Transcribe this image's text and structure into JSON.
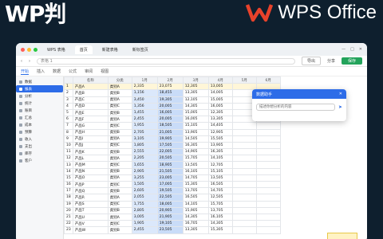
{
  "hero": {
    "title": "WP判",
    "brand_name": "WPS Office"
  },
  "colors": {
    "accent": "#2d6ce8",
    "green": "#23a35b",
    "brand_red": "#e8422b"
  },
  "titlebar": {
    "tab_active": "首页",
    "tab2": "新建表格",
    "tab3": "新标签页",
    "app_label": "WPS 表格"
  },
  "toolbar": {
    "url": "表格 1",
    "share_label": "分享",
    "green_button": "保存",
    "ghost_button": "导出"
  },
  "ribbon": {
    "tabs": [
      "开始",
      "插入",
      "数据",
      "公式",
      "审阅",
      "视图"
    ]
  },
  "sidebar": {
    "items": [
      "数据",
      "报表",
      "分析",
      "统计",
      "账目",
      "汇总",
      "成本",
      "预算",
      "收入",
      "支出",
      "库存",
      "客户"
    ]
  },
  "table": {
    "headers": [
      "",
      "名称",
      "分类",
      "1月",
      "2月",
      "3月",
      "4月",
      "5月",
      "6月"
    ],
    "rows": [
      [
        "1",
        "产品A",
        "类别A",
        "2,335",
        "23,075",
        "12,305",
        "13,005",
        "",
        ""
      ],
      [
        "2",
        "产品B",
        "类别B",
        "1,156",
        "18,455",
        "13,305",
        "14,005",
        "",
        ""
      ],
      [
        "3",
        "产品C",
        "类别A",
        "3,450",
        "19,305",
        "12,105",
        "15,005",
        "",
        ""
      ],
      [
        "4",
        "产品D",
        "类别C",
        "1,356",
        "20,005",
        "14,305",
        "16,005",
        "",
        ""
      ],
      [
        "5",
        "产品E",
        "类别B",
        "1,455",
        "16,005",
        "15,005",
        "12,305",
        "",
        ""
      ],
      [
        "6",
        "产品F",
        "类别A",
        "2,455",
        "20,005",
        "16,005",
        "13,305",
        "",
        ""
      ],
      [
        "7",
        "产品G",
        "类别C",
        "1,955",
        "18,505",
        "15,105",
        "14,405",
        "",
        ""
      ],
      [
        "8",
        "产品H",
        "类别B",
        "2,705",
        "21,005",
        "13,905",
        "12,905",
        "",
        ""
      ],
      [
        "9",
        "产品I",
        "类别A",
        "3,105",
        "19,905",
        "14,505",
        "15,505",
        "",
        ""
      ],
      [
        "10",
        "产品J",
        "类别C",
        "1,805",
        "17,505",
        "16,305",
        "13,905",
        "",
        ""
      ],
      [
        "11",
        "产品K",
        "类别B",
        "2,555",
        "22,005",
        "14,905",
        "16,305",
        "",
        ""
      ],
      [
        "12",
        "产品L",
        "类别A",
        "2,205",
        "20,505",
        "15,705",
        "14,105",
        "",
        ""
      ],
      [
        "13",
        "产品M",
        "类别C",
        "1,655",
        "18,905",
        "13,505",
        "12,705",
        "",
        ""
      ],
      [
        "14",
        "产品N",
        "类别B",
        "2,905",
        "21,505",
        "16,105",
        "15,105",
        "",
        ""
      ],
      [
        "15",
        "产品O",
        "类别A",
        "3,255",
        "23,005",
        "14,705",
        "13,505",
        "",
        ""
      ],
      [
        "16",
        "产品P",
        "类别C",
        "1,505",
        "17,005",
        "15,305",
        "16,505",
        "",
        ""
      ],
      [
        "17",
        "产品Q",
        "类别B",
        "2,605",
        "19,505",
        "13,705",
        "14,705",
        "",
        ""
      ],
      [
        "18",
        "产品R",
        "类别A",
        "2,055",
        "22,505",
        "16,505",
        "12,505",
        "",
        ""
      ],
      [
        "19",
        "产品S",
        "类别C",
        "1,755",
        "18,005",
        "14,105",
        "15,705",
        "",
        ""
      ],
      [
        "20",
        "产品T",
        "类别B",
        "2,805",
        "20,905",
        "15,905",
        "13,705",
        "",
        ""
      ],
      [
        "21",
        "产品U",
        "类别A",
        "3,005",
        "21,905",
        "14,305",
        "16,105",
        "",
        ""
      ],
      [
        "22",
        "产品V",
        "类别C",
        "1,905",
        "19,105",
        "16,705",
        "14,305",
        "",
        ""
      ],
      [
        "23",
        "产品W",
        "类别B",
        "2,455",
        "23,505",
        "13,305",
        "15,305",
        "",
        ""
      ]
    ]
  },
  "popup": {
    "title": "数据助手",
    "placeholder": "描述你想分析的内容"
  }
}
